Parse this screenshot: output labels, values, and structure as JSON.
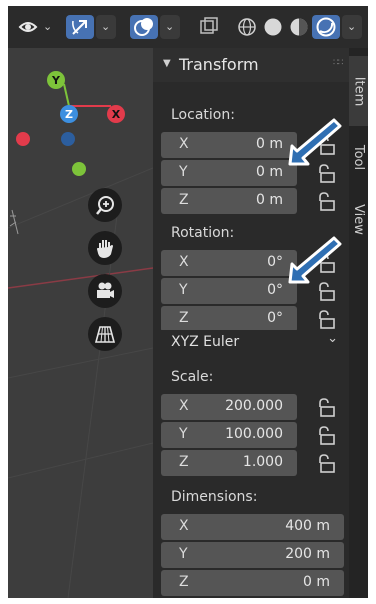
{
  "panel": {
    "title": "Transform",
    "location": {
      "label": "Location:",
      "fields": [
        {
          "axis": "X",
          "value": "0 m"
        },
        {
          "axis": "Y",
          "value": "0 m"
        },
        {
          "axis": "Z",
          "value": "0 m"
        }
      ]
    },
    "rotation": {
      "label": "Rotation:",
      "fields": [
        {
          "axis": "X",
          "value": "0°"
        },
        {
          "axis": "Y",
          "value": "0°"
        },
        {
          "axis": "Z",
          "value": "0°"
        }
      ],
      "mode": "XYZ Euler"
    },
    "scale": {
      "label": "Scale:",
      "fields": [
        {
          "axis": "X",
          "value": "200.000"
        },
        {
          "axis": "Y",
          "value": "100.000"
        },
        {
          "axis": "Z",
          "value": "1.000"
        }
      ]
    },
    "dimensions": {
      "label": "Dimensions:",
      "fields": [
        {
          "axis": "X",
          "value": "400 m"
        },
        {
          "axis": "Y",
          "value": "200 m"
        },
        {
          "axis": "Z",
          "value": "0 m"
        }
      ]
    }
  },
  "tabs": [
    "Item",
    "Tool",
    "View"
  ],
  "gizmo": {
    "y": "Y",
    "z": "Z",
    "x": "X"
  },
  "colors": {
    "highlight": "#4772b3",
    "axis_x": "#e23b4b",
    "axis_y": "#7dc33a",
    "axis_z": "#3c8fe0",
    "annotation_arrow": "#2f6fb3"
  },
  "icons": [
    "visibility-icon",
    "gizmo-toggle-icon",
    "overlays-icon",
    "xray-icon",
    "wireframe-shading-icon",
    "solid-shading-icon",
    "material-shading-icon",
    "rendered-shading-icon",
    "zoom-icon",
    "hand-pan-icon",
    "camera-icon",
    "grid-view-icon",
    "lock-icon",
    "chevron-down-icon"
  ]
}
